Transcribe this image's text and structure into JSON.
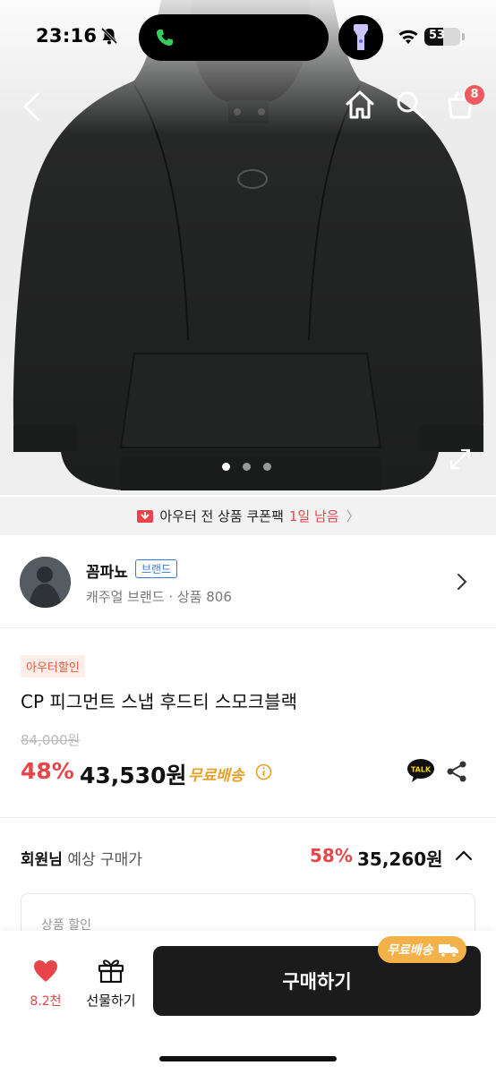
{
  "status_bar": {
    "time": "23:16",
    "battery_level": "53",
    "icons": [
      "bell-slash-icon",
      "phone-icon",
      "flashlight-icon",
      "wifi-icon",
      "battery-icon"
    ]
  },
  "header": {
    "icons": [
      "back-arrow-icon",
      "home-icon",
      "search-icon",
      "cart-icon"
    ],
    "cart_count": "8"
  },
  "gallery": {
    "page_count": 3,
    "active_index": 0
  },
  "coupon_banner": {
    "text": "아우터 전 상품 쿠폰팩",
    "highlight": "1일 남음",
    "chevron": "〉"
  },
  "brand": {
    "name": "꼼파뇨",
    "tag": "브랜드",
    "subtitle": "캐주얼 브랜드 · 상품 806"
  },
  "product": {
    "sale_badge": "아우터할인",
    "title": "CP 피그먼트 스냅 후드티 스모크블랙",
    "original_price": "84,000원",
    "discount": "48%",
    "price": "43,530원",
    "shipping": "무료배송"
  },
  "member_price": {
    "label_bold": "회원님",
    "label_rest": " 예상 구매가",
    "discount": "58%",
    "price": "35,260원"
  },
  "detail": {
    "label": "상품 할인"
  },
  "bottom_bar": {
    "like_count": "8.2천",
    "gift_label": "선물하기",
    "buy_label": "구매하기",
    "shipping_chip": "무료배송"
  },
  "colors": {
    "accent_red": "#e8454b",
    "shipping_orange": "#e6a02a",
    "brand_blue": "#3b7ae6",
    "buy_button": "#1b1b1b"
  }
}
